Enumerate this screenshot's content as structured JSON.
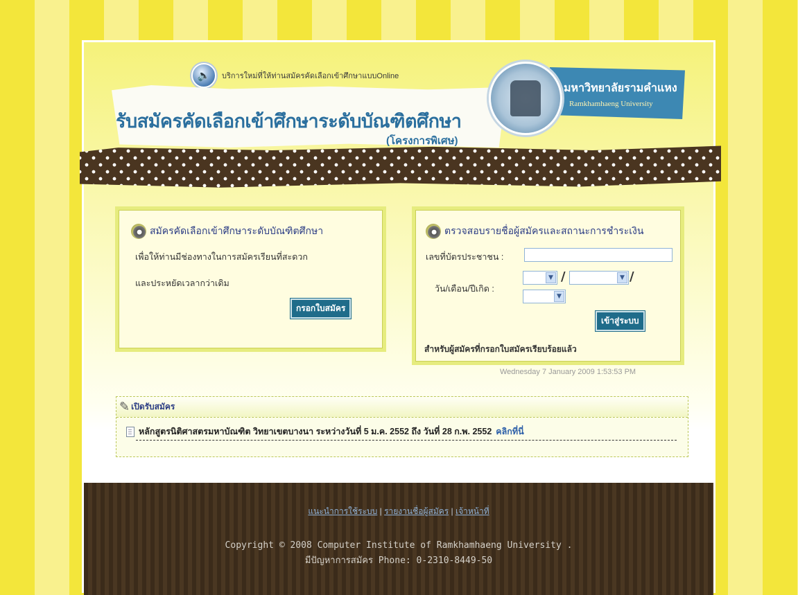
{
  "header": {
    "notice": "บริการใหม่ที่ให้ท่านสมัครคัดเลือกเข้าศึกษาแบบOnline",
    "title": "รับสมัครคัดเลือกเข้าศึกษาระดับบัณฑิตศึกษา",
    "subtitle": "(โครงการพิเศษ)",
    "university_th": "มหาวิทยาลัยรามคำแหง",
    "university_en": "Ramkhamhaeng University"
  },
  "apply_box": {
    "heading": "สมัครคัดเลือกเข้าศึกษาระดับบัณฑิตศึกษา",
    "line1": "เพื่อให้ท่านมีช่องทางในการสมัครเรียนที่สะดวก",
    "line2": "และประหยัดเวลากว่าเดิม",
    "button": "กรอกใบสมัคร"
  },
  "check_box": {
    "heading": "ตรวจสอบรายชื่อผู้สมัครและสถานะการชำระเงิน",
    "id_label": "เลขที่บัตรประชาชน :",
    "id_value": "",
    "dob_label": "วัน/เดือน/ปีเกิด :",
    "day_value": "",
    "month_value": "",
    "year_value": "",
    "separator": "/",
    "button": "เข้าสู่ระบบ",
    "note": "สำหรับผู้สมัครที่กรอกใบสมัครเรียบร้อยแล้ว"
  },
  "datetime": "Wednesday 7 January 2009  1:53:53 PM",
  "news": {
    "heading": "เปิดรับสมัคร",
    "item": "หลักสูตรนิติศาสตรมหาบัณฑิต วิทยาเขตบางนา ระหว่างวันที่ 5 ม.ค. 2552 ถึง วันที่ 28 ก.พ. 2552",
    "link": "คลิกที่นี่"
  },
  "footer": {
    "links": [
      "แนะนำการใช้ระบบ",
      "รายงานชื่อผู้สมัคร",
      "เจ้าหน้าที่"
    ],
    "separator": "|",
    "copyright": "Copyright © 2008 Computer Institute of Ramkhamhaeng University .",
    "contact": "มีปัญหาการสมัคร Phone: 0-2310-8449-50"
  },
  "icons": {
    "speaker": "speaker-icon",
    "bullet": "disc-icon",
    "notepad": "notepad-icon",
    "document": "document-icon"
  },
  "colors": {
    "title_blue": "#2b6f9e",
    "button_teal": "#1f6c8a",
    "footer_brown": "#3b2b1a",
    "stripe_yellow": "#f3e63b"
  }
}
